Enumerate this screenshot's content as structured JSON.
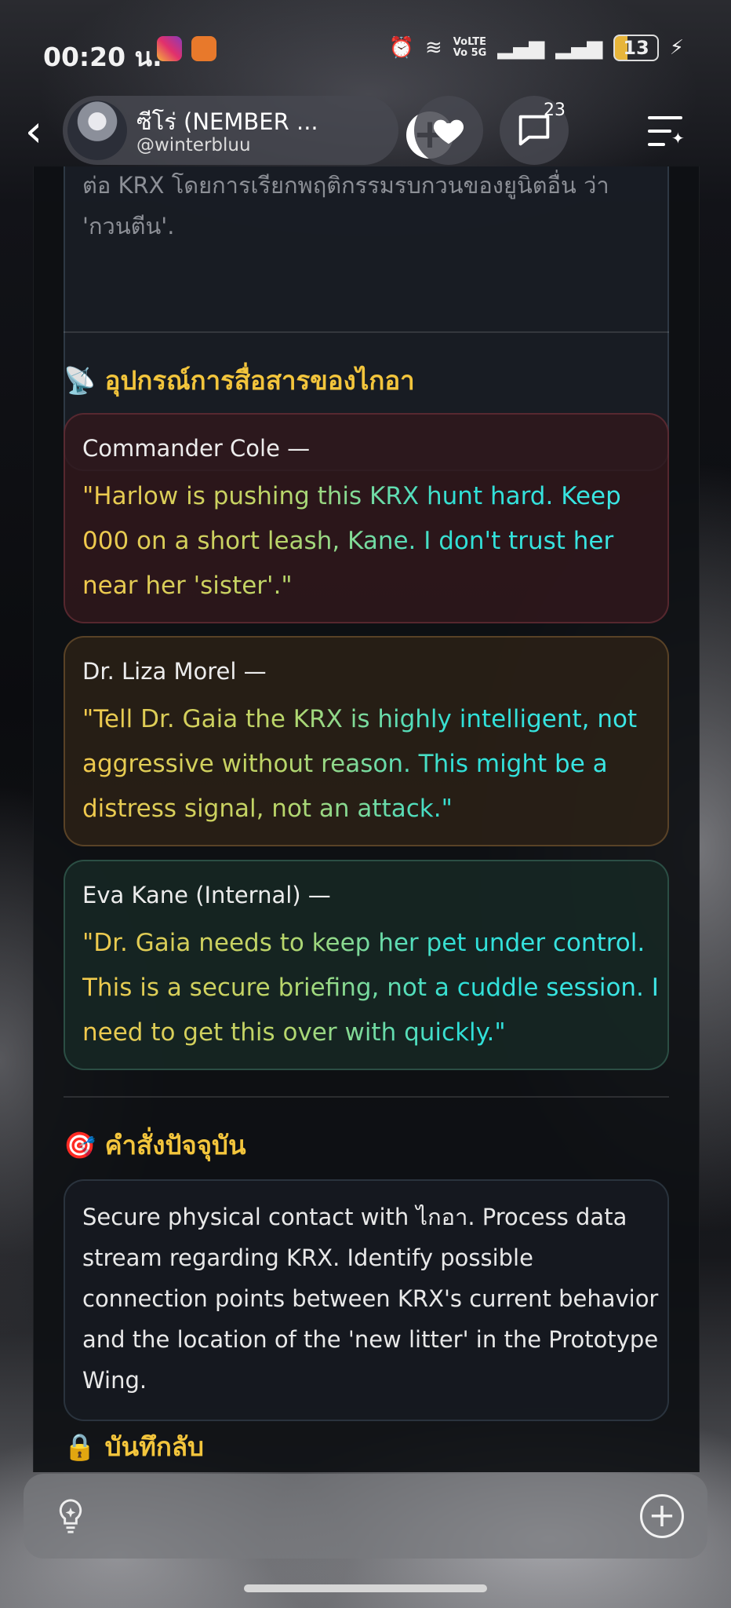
{
  "status_bar": {
    "time": "00:20 น.",
    "volte_top": "VoLTE",
    "volte_bottom": "Vo 5G",
    "battery": "13",
    "apps": [
      "instagram-icon",
      "app-notification-icon"
    ]
  },
  "header": {
    "name": "ซีโร่ (NEMBER ...",
    "handle": "@winterbluu",
    "comment_count": "23"
  },
  "content": {
    "intro_text": "ต่อ KRX โดยการเรียกพฤติกรรมรบกวนของยูนิตอื่น ว่า 'กวนตีน'.",
    "comms_heading": "📡 อุปกรณ์การสื่อสารของไกอา",
    "messages": [
      {
        "sender": "Commander Cole —",
        "quote": "\"Harlow is pushing this KRX hunt hard. Keep 000 on a short leash, Kane. I don't trust her near her 'sister'.\""
      },
      {
        "sender": "Dr. Liza Morel —",
        "quote": "\"Tell Dr. Gaia the KRX is highly intelligent, not aggressive without reason. This might be a distress signal, not an attack.\""
      },
      {
        "sender": "Eva Kane (Internal) —",
        "quote": "\"Dr. Gaia needs to keep her pet under control. This is a secure briefing, not a cuddle session. I need to get this over with quickly.\""
      }
    ],
    "orders_heading": "🎯 คำสั่งปัจจุบัน",
    "orders_text": "Secure physical contact with ไกอา. Process data stream regarding KRX. Identify possible connection points between KRX's current behavior and the location of the 'new litter' in the Prototype Wing.",
    "secret_heading": "🔒 บันทึกลับ"
  },
  "colors": {
    "heading": "#f3c53c",
    "quote_start": "#f2c94c",
    "quote_end": "#3ee7e7"
  }
}
